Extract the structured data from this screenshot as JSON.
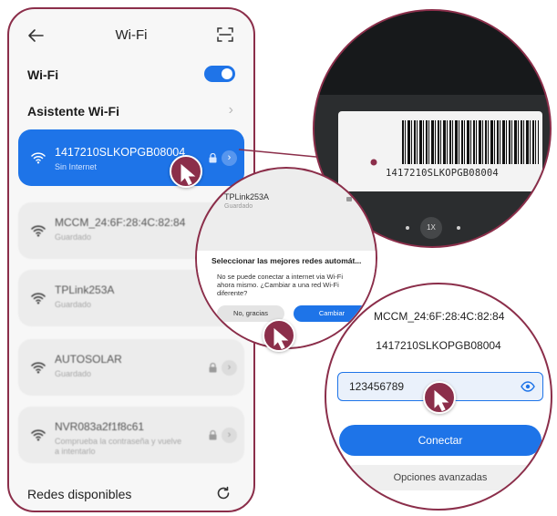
{
  "phone": {
    "header": {
      "title": "Wi-Fi",
      "back_icon": "back-arrow-icon",
      "scan_icon": "scan-qr-icon"
    },
    "wifi_toggle": {
      "label": "Wi-Fi",
      "state": "on"
    },
    "assistant": {
      "label": "Asistente Wi-Fi"
    },
    "networks": [
      {
        "name": "1417210SLKOPGB08004",
        "status": "Sin Internet",
        "locked": true,
        "selected": true
      },
      {
        "name": "MCCM_24:6F:28:4C:82:84",
        "status": "Guardado",
        "locked": true,
        "selected": false
      },
      {
        "name": "TPLink253A",
        "status": "Guardado",
        "locked": true,
        "selected": false
      },
      {
        "name": "AUTOSOLAR",
        "status": "Guardado",
        "locked": true,
        "selected": false
      },
      {
        "name": "NVR083a2f1f8c61",
        "status": "Comprueba la contraseña y vuelve a intentarlo",
        "locked": true,
        "selected": false
      }
    ],
    "available": {
      "label": "Redes disponibles"
    }
  },
  "zoom_label": {
    "serial": "1417210SLKOPGB08004",
    "zoom_level": "1X"
  },
  "zoom_dialog": {
    "background_network": {
      "name": "TPLink253A",
      "status": "Guardado"
    },
    "title": "Seleccionar las mejores redes automát...",
    "body": "No se puede conectar a internet via Wi-Fi ahora mismo. ¿Cambiar a una red Wi-Fi diferente?",
    "cancel_label": "No, gracias",
    "confirm_label": "Cambiar"
  },
  "zoom_password": {
    "previous_network": "MCCM_24:6F:28:4C:82:84",
    "ssid": "1417210SLKOPGB08004",
    "password_value": "123456789",
    "connect_label": "Conectar",
    "advanced_label": "Opciones avanzadas"
  },
  "colors": {
    "accent": "#1e74e8",
    "outline": "#8b2e4a"
  }
}
